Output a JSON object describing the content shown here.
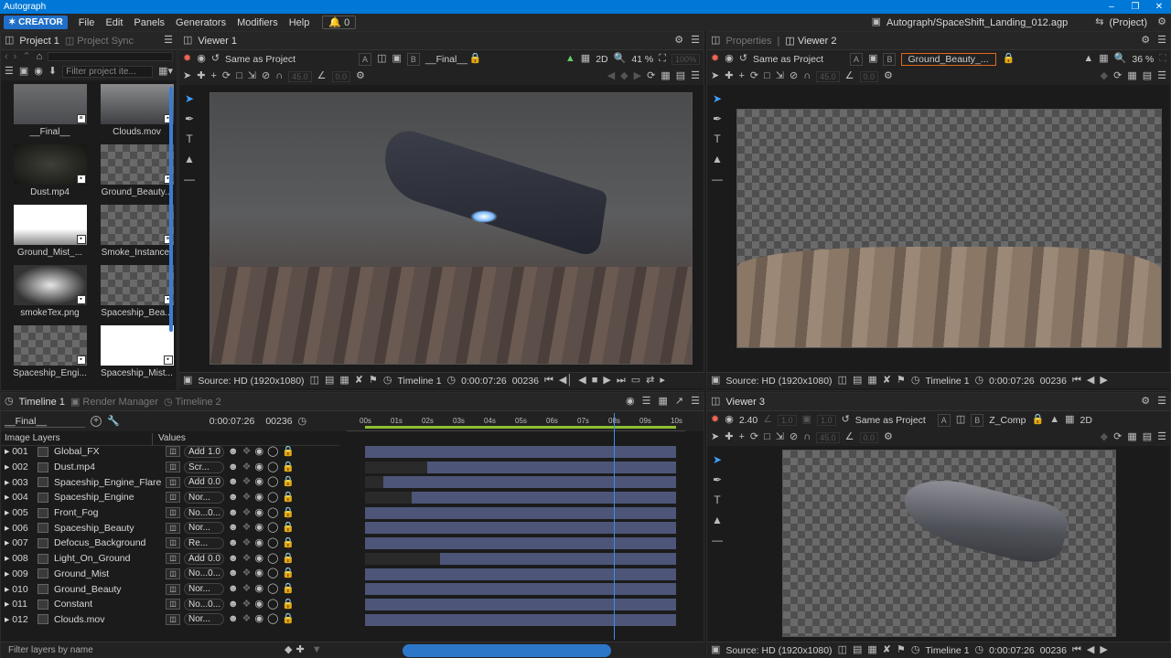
{
  "app": {
    "title": "Autograph",
    "edition": "CREATOR",
    "project_path": "Autograph/SpaceShift_Landing_012.agp",
    "project_scope": "(Project)",
    "notifications": "0"
  },
  "menu": [
    "File",
    "Edit",
    "Panels",
    "Generators",
    "Modifiers",
    "Help"
  ],
  "project_panel": {
    "tabs": [
      "Project 1",
      "Project Sync"
    ],
    "filter_placeholder": "Filter project ite...",
    "items": [
      {
        "label": "__Final__",
        "kind": "comp"
      },
      {
        "label": "Clouds.mov",
        "kind": "video"
      },
      {
        "label": "Dust.mp4",
        "kind": "video"
      },
      {
        "label": "Ground_Beauty...",
        "kind": "image"
      },
      {
        "label": "Ground_Mist_...",
        "kind": "image"
      },
      {
        "label": "Smoke_Instancer",
        "kind": "comp"
      },
      {
        "label": "smokeTex.png",
        "kind": "image"
      },
      {
        "label": "Spaceship_Bea...",
        "kind": "image"
      },
      {
        "label": "Spaceship_Engi...",
        "kind": "image"
      },
      {
        "label": "Spaceship_Mist...",
        "kind": "image"
      }
    ]
  },
  "viewer1": {
    "tab": "Viewer 1",
    "colorspace": "Same as Project",
    "dim": "2D",
    "zoom": "41 %",
    "zoom_max": "100%",
    "comp": "__Final__",
    "angle": "45.0",
    "offset": "0.0",
    "source": "Source: HD (1920x1080)",
    "timeline": "Timeline 1",
    "timecode": "0:00:07:26",
    "frame": "00236"
  },
  "viewer2": {
    "tabs": [
      "Properties",
      "Viewer 2"
    ],
    "colorspace": "Same as Project",
    "comp": "Ground_Beauty_...",
    "zoom": "36 %",
    "angle": "45.0",
    "offset": "0.0",
    "source": "Source: HD (1920x1080)",
    "timeline": "Timeline 1",
    "timecode": "0:00:07:26",
    "frame": "00236"
  },
  "viewer3": {
    "tab": "Viewer 3",
    "exposure": "2.40",
    "gamma": "1.0",
    "opacity": "1.0",
    "colorspace": "Same as Project",
    "comp": "Z_Comp",
    "dim": "2D",
    "angle": "45.0",
    "offset": "0.0",
    "source": "Source: HD (1920x1080)",
    "timeline": "Timeline 1",
    "timecode": "0:00:07:26",
    "frame": "00236"
  },
  "timeline": {
    "tabs": [
      "Timeline 1",
      "Render Manager",
      "Timeline 2"
    ],
    "comp": "__Final__",
    "timecode": "0:00:07:26",
    "frame": "00236",
    "col_layers": "Image Layers",
    "col_values": "Values",
    "ruler": [
      "00s",
      "01s",
      "02s",
      "03s",
      "04s",
      "05s",
      "06s",
      "07s",
      "08s",
      "09s",
      "10s"
    ],
    "playhead_seconds": 8.0,
    "filter_placeholder": "Filter layers by name",
    "layers": [
      {
        "num": "001",
        "name": "Global_FX",
        "mode": "Add",
        "op": "1.0",
        "start": 0.0
      },
      {
        "num": "002",
        "name": "Dust.mp4",
        "mode": "Scr...",
        "op": "",
        "start": 2.0
      },
      {
        "num": "003",
        "name": "Spaceship_Engine_Flare",
        "mode": "Add",
        "op": "0.0",
        "start": 0.6
      },
      {
        "num": "004",
        "name": "Spaceship_Engine",
        "mode": "Nor...",
        "op": "",
        "start": 1.5
      },
      {
        "num": "005",
        "name": "Front_Fog",
        "mode": "No...",
        "op": "0...",
        "start": 0.0
      },
      {
        "num": "006",
        "name": "Spaceship_Beauty",
        "mode": "Nor...",
        "op": "",
        "start": 0.0
      },
      {
        "num": "007",
        "name": "Defocus_Background",
        "mode": "Re...",
        "op": "",
        "start": 0.0
      },
      {
        "num": "008",
        "name": "Light_On_Ground",
        "mode": "Add",
        "op": "0.0",
        "start": 2.4
      },
      {
        "num": "009",
        "name": "Ground_Mist",
        "mode": "No...",
        "op": "0...",
        "start": 0.0
      },
      {
        "num": "010",
        "name": "Ground_Beauty",
        "mode": "Nor...",
        "op": "",
        "start": 0.0
      },
      {
        "num": "011",
        "name": "Constant",
        "mode": "No...",
        "op": "0...",
        "start": 0.0
      },
      {
        "num": "012",
        "name": "Clouds.mov",
        "mode": "Nor...",
        "op": "",
        "start": 0.0
      }
    ]
  }
}
